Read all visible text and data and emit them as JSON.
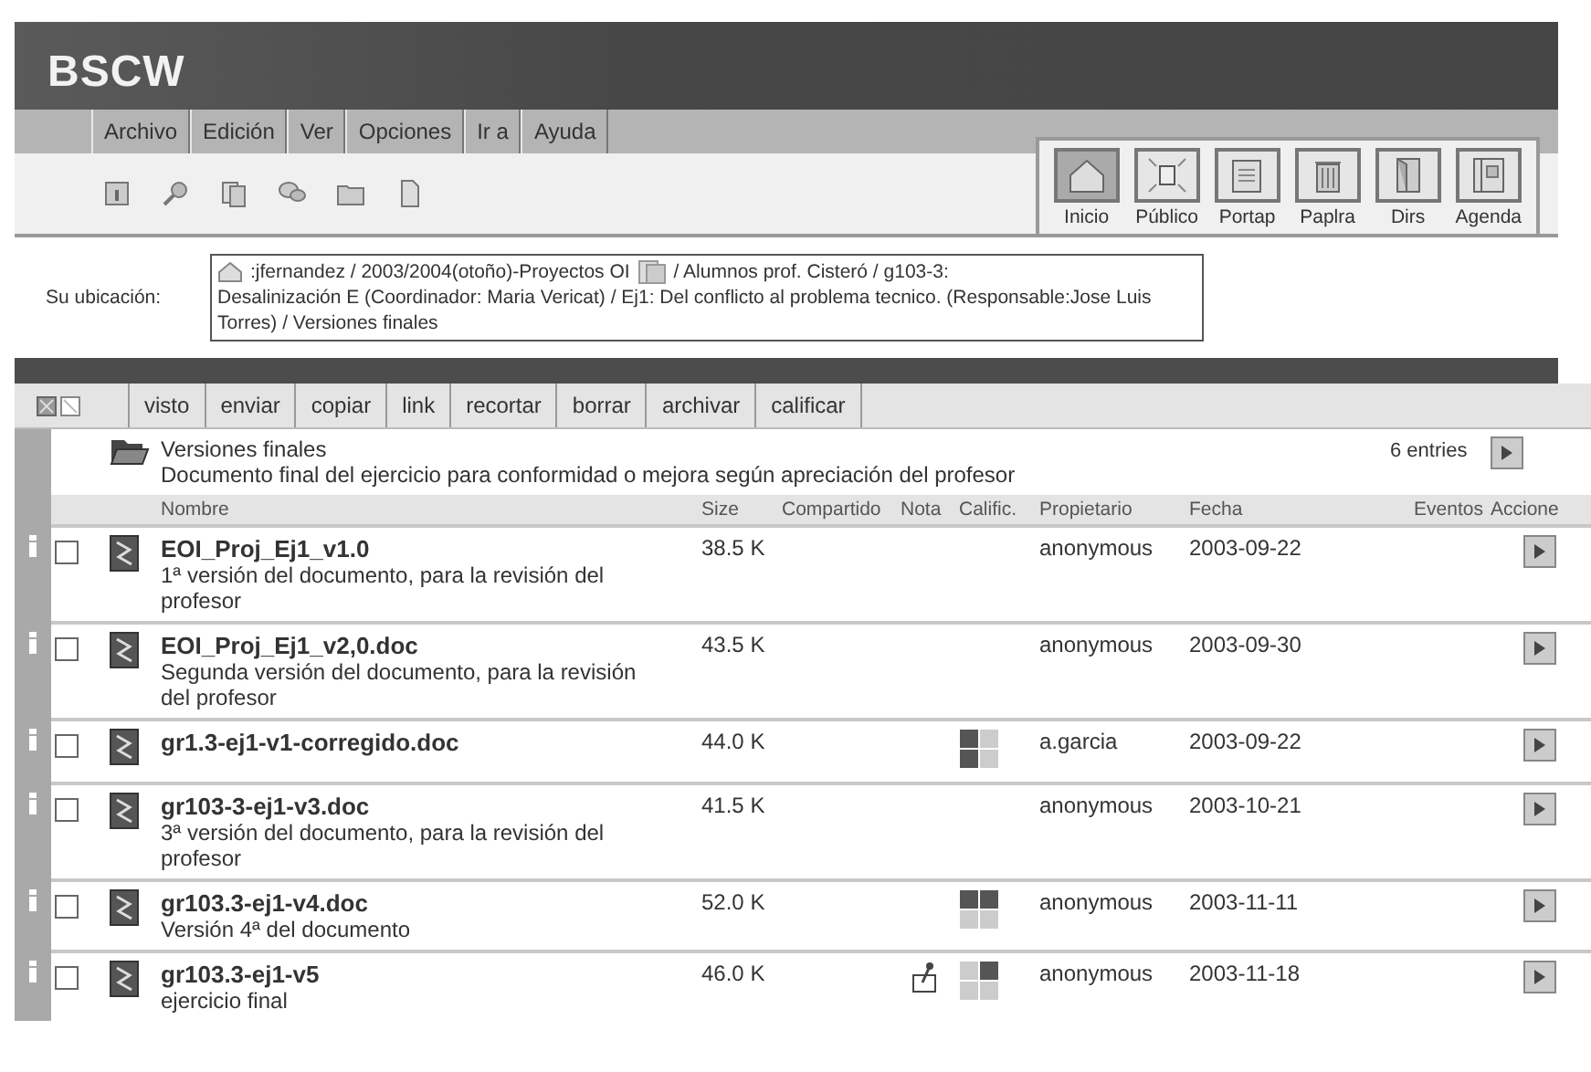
{
  "logo": "BSCW",
  "menu": [
    "Archivo",
    "Edición",
    "Ver",
    "Opciones",
    "Ir a",
    "Ayuda"
  ],
  "nav_buttons": [
    {
      "label": "Inicio",
      "selected": true,
      "kind": "home"
    },
    {
      "label": "Público",
      "selected": false,
      "kind": "public"
    },
    {
      "label": "Portap",
      "selected": false,
      "kind": "clipboard"
    },
    {
      "label": "Paplra",
      "selected": false,
      "kind": "trash"
    },
    {
      "label": "Dirs",
      "selected": false,
      "kind": "book"
    },
    {
      "label": "Agenda",
      "selected": false,
      "kind": "agenda"
    }
  ],
  "location": {
    "label": "Su ubicación:",
    "path_start": ":jfernandez / 2003/2004(otoño)-Proyectos OI",
    "path_middle": "/ Alumnos prof. Cisteró / g103-3:",
    "path_rest": "Desalinización E (Coordinador: Maria Vericat) / Ej1: Del conflicto al problema tecnico. (Responsable:Jose Luis Torres) / Versiones finales"
  },
  "actions": [
    "visto",
    "enviar",
    "copiar",
    "link",
    "recortar",
    "borrar",
    "archivar",
    "calificar"
  ],
  "folder": {
    "name": "Versiones finales",
    "description": "Documento final del ejercicio para conformidad o mejora según apreciación del profesor",
    "count": "6 entries"
  },
  "columns": [
    "Nombre",
    "Size",
    "Compartido",
    "Nota",
    "Calific.",
    "Propietario",
    "Fecha",
    "Eventos",
    "Accione"
  ],
  "rows": [
    {
      "name": "EOI_Proj_Ej1_v1.0",
      "description": "1ª versión del documento, para la revisión del profesor",
      "size": "38.5 K",
      "owner": "anonymous",
      "date": "2003-09-22",
      "checked": false
    },
    {
      "name": "EOI_Proj_Ej1_v2,0.doc",
      "description": "Segunda versión del documento, para la revisión del profesor",
      "size": "43.5 K",
      "owner": "anonymous",
      "date": "2003-09-30",
      "checked": false
    },
    {
      "name": "gr1.3-ej1-v1-corregido.doc",
      "size": "44.0 K",
      "grade": [
        true,
        false,
        true,
        false
      ],
      "owner": "a.garcia",
      "date": "2003-09-22",
      "checked": false
    },
    {
      "name": "gr103-3-ej1-v3.doc",
      "description": "3ª versión del documento, para la revisión del profesor",
      "size": "41.5 K",
      "owner": "anonymous",
      "date": "2003-10-21",
      "checked": false
    },
    {
      "name": "gr103.3-ej1-v4.doc",
      "description": "Versión 4ª del documento",
      "size": "52.0 K",
      "grade": [
        true,
        true,
        false,
        false
      ],
      "owner": "anonymous",
      "date": "2003-11-11",
      "checked": false
    },
    {
      "name": "gr103.3-ej1-v5",
      "description": "ejercicio final",
      "size": "46.0 K",
      "note": true,
      "grade": [
        false,
        true,
        false,
        false
      ],
      "owner": "anonymous",
      "date": "2003-11-18",
      "checked": false
    }
  ]
}
